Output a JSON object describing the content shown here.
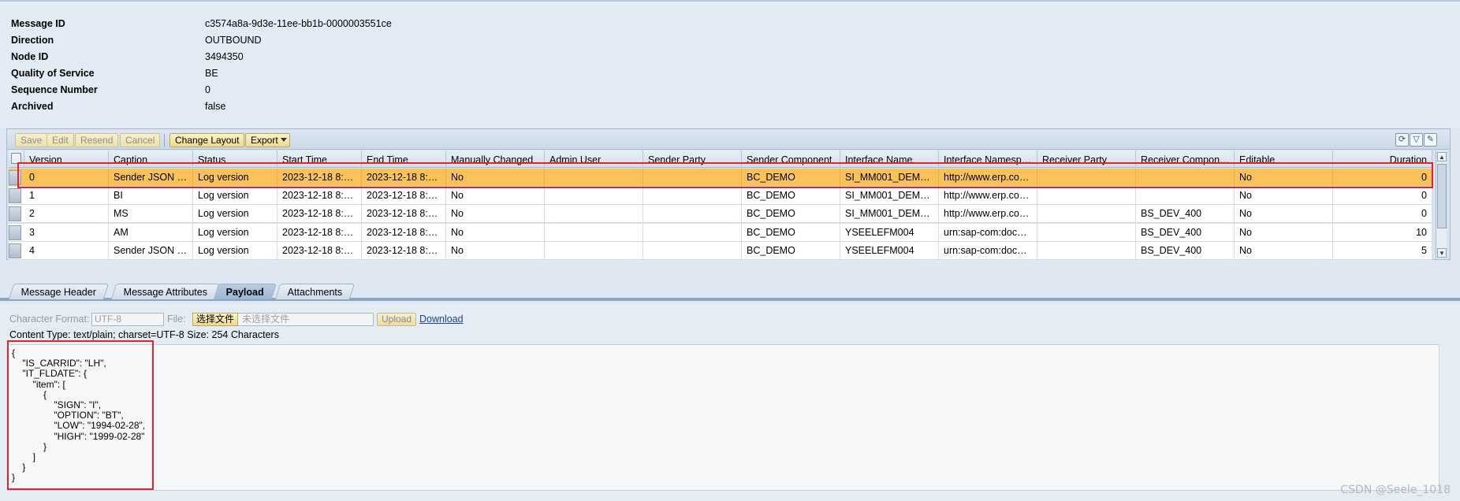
{
  "details": [
    {
      "label": "Message ID",
      "value": "c3574a8a-9d3e-11ee-bb1b-0000003551ce"
    },
    {
      "label": "Direction",
      "value": "OUTBOUND"
    },
    {
      "label": "Node ID",
      "value": "3494350"
    },
    {
      "label": "Quality of Service",
      "value": "BE"
    },
    {
      "label": "Sequence Number",
      "value": "0"
    },
    {
      "label": "Archived",
      "value": "false"
    }
  ],
  "toolbar": {
    "save": "Save",
    "edit": "Edit",
    "resend": "Resend",
    "cancel": "Cancel",
    "change_layout": "Change Layout",
    "export": "Export"
  },
  "table": {
    "columns": [
      "Version",
      "Caption",
      "Status",
      "Start Time",
      "End Time",
      "Manually Changed",
      "Admin User",
      "Sender Party",
      "Sender Component",
      "Interface Name",
      "Interface Namesp…",
      "Receiver Party",
      "Receiver Compon…",
      "Editable",
      "Duration"
    ],
    "rows": [
      [
        "0",
        "Sender JSON …",
        "Log version",
        "2023-12-18 8:…",
        "2023-12-18 8:…",
        "No",
        "",
        "",
        "BC_DEMO",
        "SI_MM001_DEM…",
        "http://www.erp.co…",
        "",
        "",
        "No",
        "0"
      ],
      [
        "1",
        "BI",
        "Log version",
        "2023-12-18 8:…",
        "2023-12-18 8:…",
        "No",
        "",
        "",
        "BC_DEMO",
        "SI_MM001_DEM…",
        "http://www.erp.co…",
        "",
        "",
        "No",
        "0"
      ],
      [
        "2",
        "MS",
        "Log version",
        "2023-12-18 8:…",
        "2023-12-18 8:…",
        "No",
        "",
        "",
        "BC_DEMO",
        "SI_MM001_DEM…",
        "http://www.erp.co…",
        "",
        "BS_DEV_400",
        "No",
        "0"
      ],
      [
        "3",
        "AM",
        "Log version",
        "2023-12-18 8:…",
        "2023-12-18 8:…",
        "No",
        "",
        "",
        "BC_DEMO",
        "YSEELEFM004",
        "urn:sap-com:doc…",
        "",
        "BS_DEV_400",
        "No",
        "10"
      ],
      [
        "4",
        "Sender JSON …",
        "Log version",
        "2023-12-18 8:…",
        "2023-12-18 8:…",
        "No",
        "",
        "",
        "BC_DEMO",
        "YSEELEFM004",
        "urn:sap-com:doc…",
        "",
        "BS_DEV_400",
        "No",
        "5"
      ]
    ],
    "selected_row": 0
  },
  "tabs": [
    "Message Header",
    "Message Attributes",
    "Payload",
    "Attachments"
  ],
  "active_tab": "Payload",
  "payload": {
    "char_format_label": "Character Format:",
    "char_format_value": "UTF-8",
    "file_label": "File:",
    "choose_file": "选择文件",
    "no_file": "未选择文件",
    "upload": "Upload",
    "download": "Download",
    "content_type": "Content Type:  text/plain; charset=UTF-8 Size:  254 Characters",
    "lines": [
      "{",
      "    \"IS_CARRID\": \"LH\",",
      "    \"IT_FLDATE\": {",
      "        \"item\": [",
      "            {",
      "                \"SIGN\": \"I\",",
      "                \"OPTION\": \"BT\",",
      "                \"LOW\": \"1994-02-28\",",
      "                \"HIGH\": \"1999-02-28\"",
      "            }",
      "        ]",
      "    }",
      "}"
    ]
  },
  "watermark": "CSDN @Seele_1018",
  "colors": {
    "selected_row": "#fbc25a",
    "highlight_border": "#e0242c",
    "link": "#1c3fa8"
  }
}
